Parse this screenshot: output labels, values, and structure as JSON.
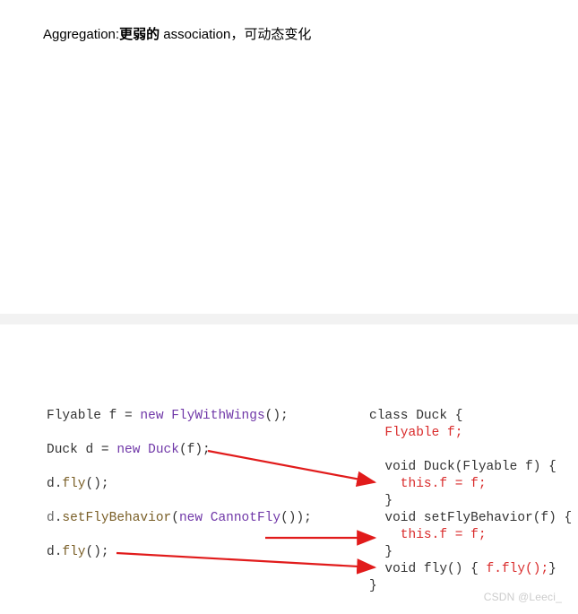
{
  "heading": {
    "label": "Aggregation:",
    "part1": "更弱的",
    "mid": " association",
    "sep": "，可",
    "part2": "动态变化"
  },
  "code_left": {
    "l1a": "Flyable f = ",
    "l1b": "new",
    "l1c": " ",
    "l1d": "FlyWithWings",
    "l1e": "();",
    "l2a": "Duck d = ",
    "l2b": "new",
    "l2c": " ",
    "l2d": "Duck",
    "l2e": "(f);",
    "l3a": "d.",
    "l3b": "fly",
    "l3c": "();",
    "l4a": "d",
    "l4b": ".",
    "l4c": "setFlyBehavior",
    "l4d": "(",
    "l4e": "new",
    "l4f": " ",
    "l4g": "CannotFly",
    "l4h": "());",
    "l5a": "d.",
    "l5b": "fly",
    "l5c": "();"
  },
  "code_right": {
    "r1": "class Duck {",
    "r2": "  Flyable f;",
    "r3": "",
    "r4": "  void Duck(Flyable f) {",
    "r5": "    this.f = f;",
    "r6": "  }",
    "r7": "  void setFlyBehavior(f) {",
    "r8": "    this.f = f;",
    "r9": "  }",
    "r10a": "  void fly() { ",
    "r10b": "f.fly();",
    "r10c": "}",
    "r11": "}"
  },
  "watermark": "CSDN @Leeci_"
}
